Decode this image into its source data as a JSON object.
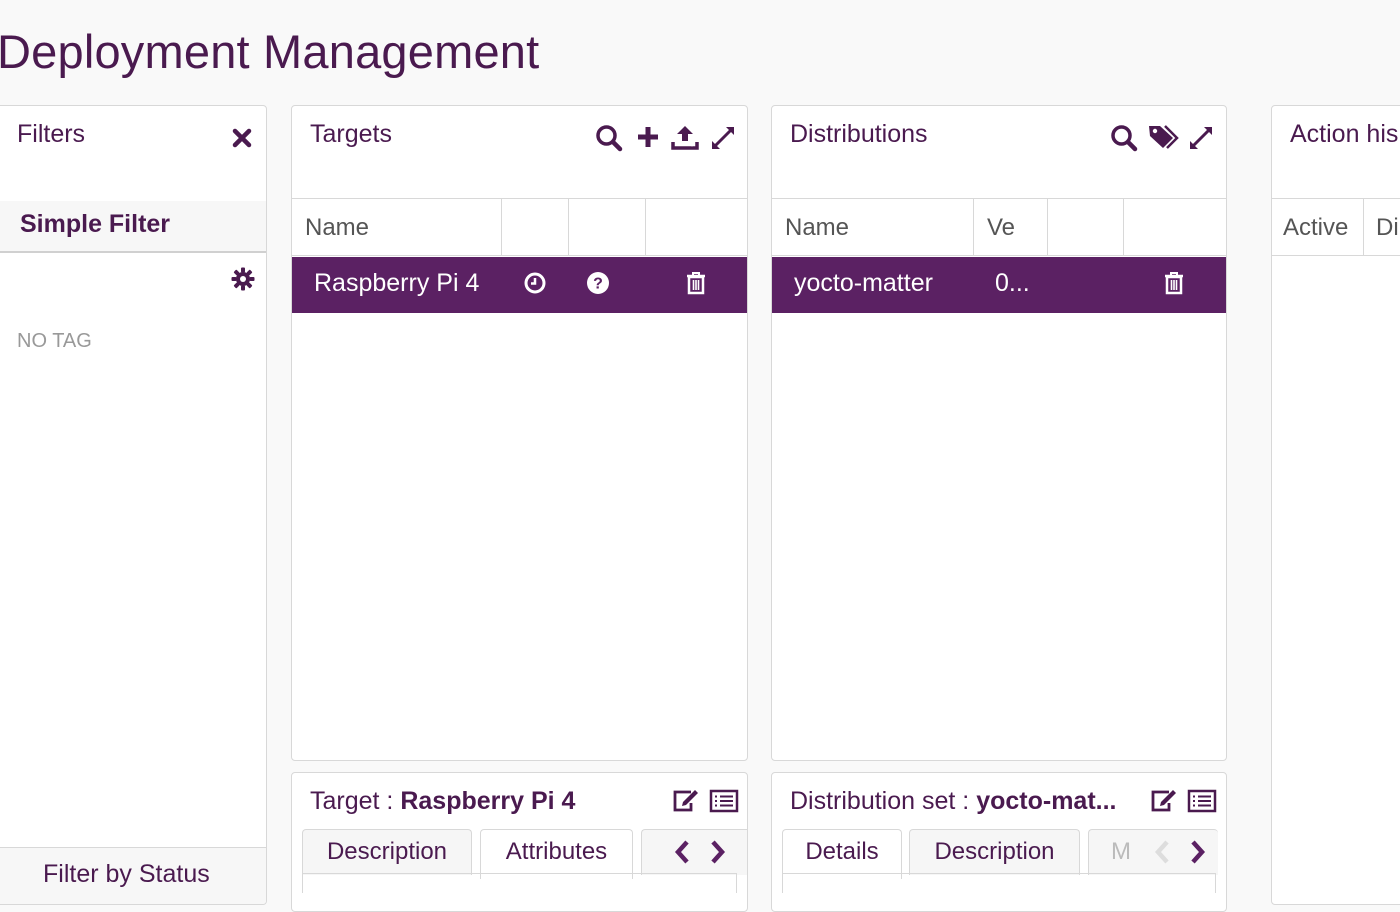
{
  "page": {
    "title": "Deployment Management"
  },
  "filters": {
    "title": "Filters",
    "simple_filter_label": "Simple Filter",
    "no_tag_label": "NO TAG",
    "filter_by_status_label": "Filter by Status"
  },
  "targets": {
    "title": "Targets",
    "columns": [
      "Name",
      "",
      "",
      ""
    ],
    "rows": [
      {
        "name": "Raspberry Pi 4",
        "selected": true,
        "icons": [
          "clock-icon",
          "question-icon",
          "trash-icon"
        ]
      }
    ]
  },
  "distributions": {
    "title": "Distributions",
    "columns": [
      "Name",
      "Ve",
      "",
      ""
    ],
    "rows": [
      {
        "name": "yocto-matter",
        "version": "0...",
        "selected": true,
        "icons": [
          "trash-icon"
        ]
      }
    ]
  },
  "action_history": {
    "title": "Action his",
    "columns": [
      "Active",
      "Di"
    ]
  },
  "target_details": {
    "title_prefix": "Target : ",
    "title_value": "Raspberry Pi 4",
    "tabs": [
      "Description",
      "Attributes"
    ],
    "active_tab": "Attributes"
  },
  "distribution_details": {
    "title_prefix": "Distribution set : ",
    "title_value": "yocto-mat...",
    "tabs": [
      "Details",
      "Description",
      "M"
    ],
    "active_tab": "Details"
  },
  "colors": {
    "accent": "#4a1a4f",
    "selected_row": "#5b2163",
    "border": "#d8d8d8",
    "muted_text": "#999999"
  }
}
